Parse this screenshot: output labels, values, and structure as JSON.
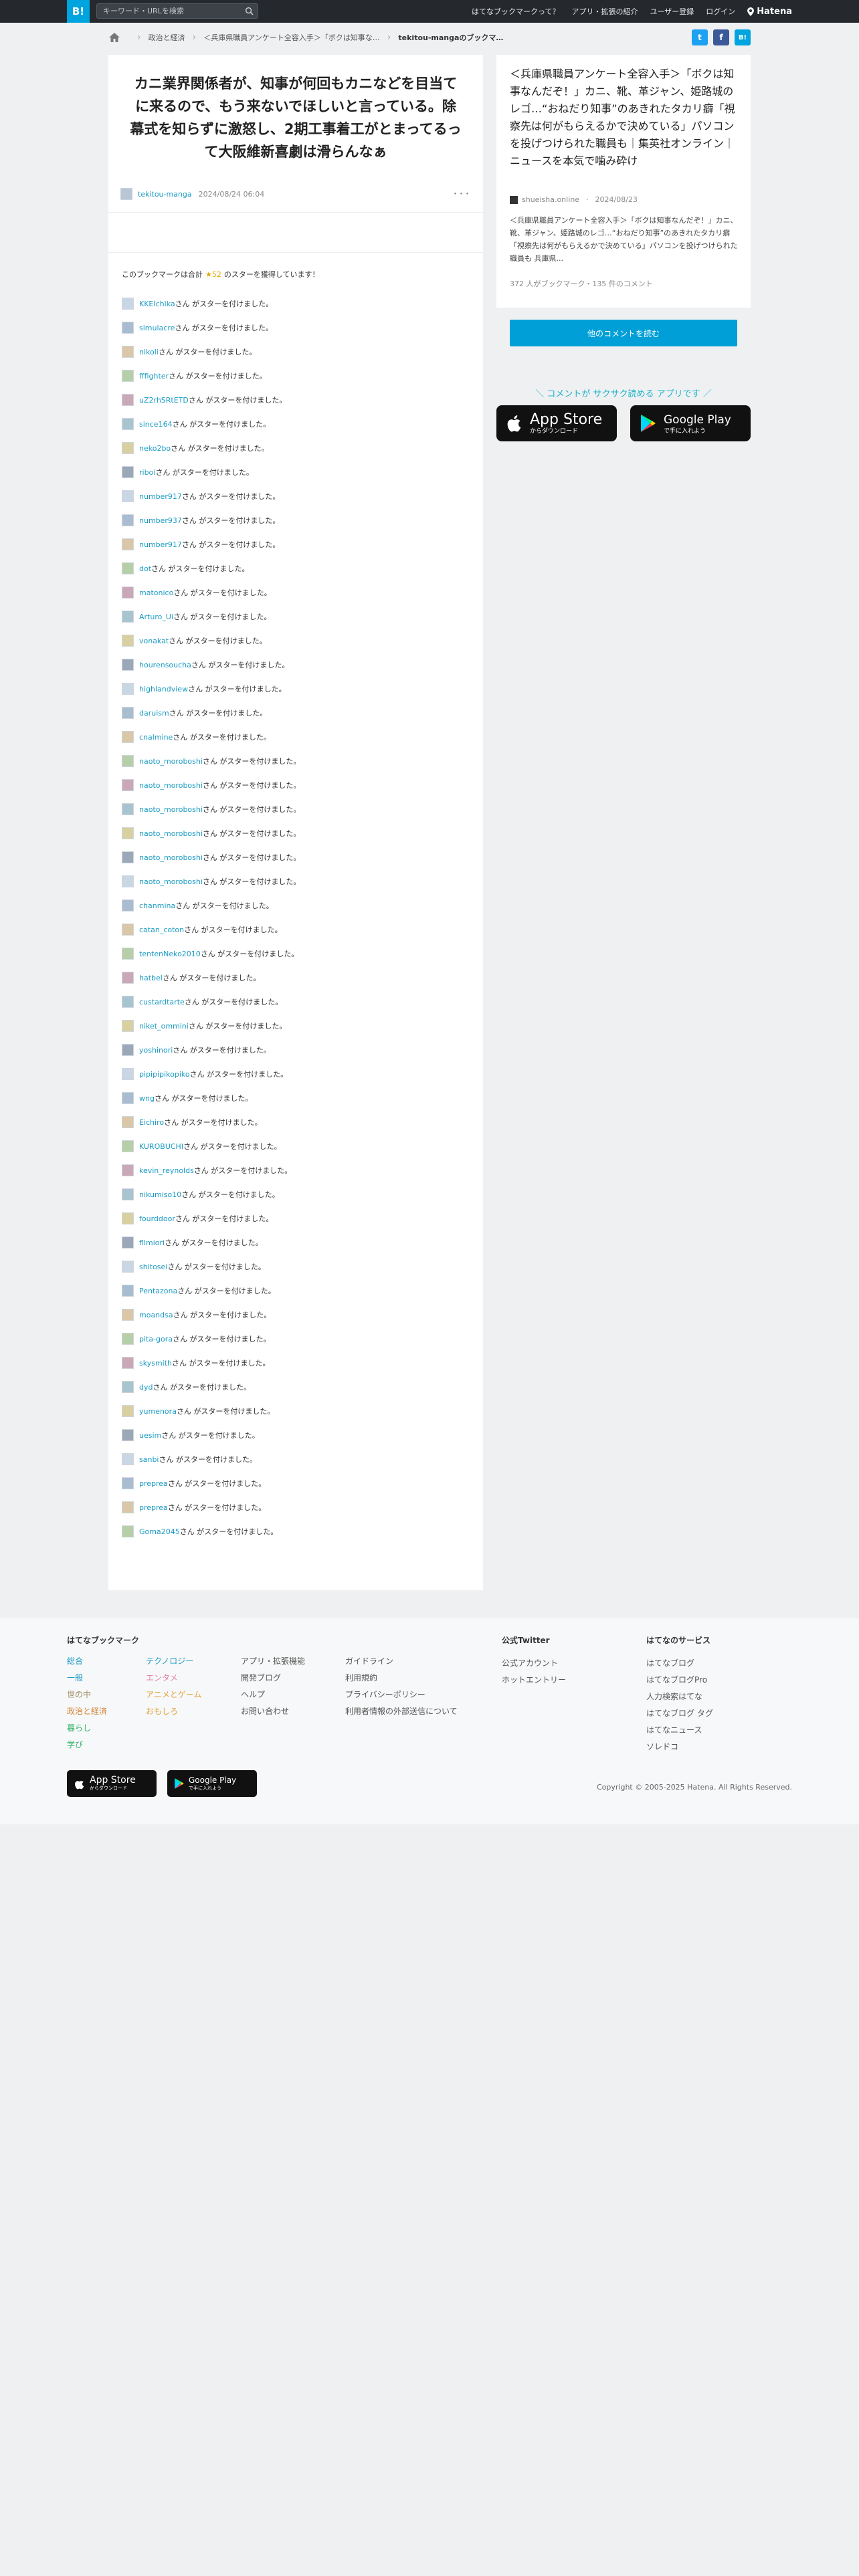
{
  "topbar": {
    "logo": "B!",
    "search_placeholder": "キーワード・URLを検索",
    "links": [
      "はてなブックマークって？",
      "アプリ・拡張の紹介",
      "ユーザー登録",
      "ログイン"
    ],
    "brand": "Hatena"
  },
  "breadcrumb": {
    "items": [
      "政治と経済",
      "＜兵庫県職員アンケート全容入手＞「ボクは知事な…"
    ],
    "current": "tekitou-mangaのブックマ…"
  },
  "share": {
    "twitter": "t",
    "facebook": "f",
    "hatena": "B!"
  },
  "bookmark": {
    "title": "カニ業界関係者が、知事が何回もカニなどを目当てに来るので、もう来ないでほしいと言っている。除幕式を知らずに激怒し、2期工事着工がとまってるって大阪維新喜劇は滑らんなぁ",
    "user": "tekitou-manga",
    "date": "2024/08/24 06:04",
    "more": "･･･"
  },
  "stars": {
    "summary_before": "このブックマークは合計",
    "summary_count": "★52",
    "summary_after": "のスターを獲得しています！",
    "suffix": "さん がスターを付けました。",
    "users": [
      "KKEIchika",
      "simulacre",
      "nikoli",
      "fffighter",
      "uZ2rhSRtETD",
      "since164",
      "neko2bo",
      "riboi",
      "number917",
      "number937",
      "number917",
      "dot",
      "matonico",
      "Arturo_Ui",
      "vonakat",
      "hourensoucha",
      "highlandview",
      "daruism",
      "cnalmine",
      "naoto_moroboshi",
      "naoto_moroboshi",
      "naoto_moroboshi",
      "naoto_moroboshi",
      "naoto_moroboshi",
      "naoto_moroboshi",
      "chanmina",
      "catan_coton",
      "tentenNeko2010",
      "hatbel",
      "custardtarte",
      "niket_ommini",
      "yoshinori",
      "pipipipikopiko",
      "wng",
      "Eichiro",
      "KUROBUCHI",
      "kevin_reynolds",
      "nikumiso10",
      "fourddoor",
      "fllmiori",
      "shitosei",
      "Pentazona",
      "moandsa",
      "pita-gora",
      "skysmith",
      "dyd",
      "yumenora",
      "uesim",
      "sanbi",
      "preprea",
      "preprea",
      "Goma2045"
    ]
  },
  "entry": {
    "title": "＜兵庫県職員アンケート全容入手＞「ボクは知事なんだぞ！」カニ、靴、革ジャン、姫路城のレゴ…“おねだり知事”のあきれたタカリ癖「視察先は何がもらえるかで決めている」パソコンを投げつけられた職員も｜集英社オンライン｜ニュースを本気で噛み砕け",
    "publisher": "shueisha.online",
    "date": "2024/08/23",
    "description": "＜兵庫県職員アンケート全容入手＞「ボクは知事なんだぞ！」カニ、靴、革ジャン、姫路城のレゴ…“おねだり知事”のあきれたタカリ癖「視察先は何がもらえるかで決めている」パソコンを投げつけられた職員も 兵庫県...",
    "stats": "372 人がブックマーク・135 件のコメント",
    "read_button": "他のコメントを読む"
  },
  "promo": {
    "text": "＼ コメントが サクサク読める アプリです ／",
    "appstore_big": "App Store",
    "appstore_small": "からダウンロード",
    "gplay_big": "Google Play",
    "gplay_small": "で手に入れよう"
  },
  "footer": {
    "col1_title": "はてなブックマーク",
    "col1": [
      "総合",
      "一般",
      "世の中",
      "政治と経済",
      "暮らし",
      "学び"
    ],
    "col2": [
      "テクノロジー",
      "エンタメ",
      "アニメとゲーム",
      "おもしろ"
    ],
    "col3": [
      "アプリ・拡張機能",
      "開発ブログ",
      "ヘルプ",
      "お問い合わせ"
    ],
    "col4": [
      "ガイドライン",
      "利用規約",
      "プライバシーポリシー",
      "利用者情報の外部送信について"
    ],
    "col5_title": "公式Twitter",
    "col5": [
      "公式アカウント",
      "ホットエントリー"
    ],
    "col6_title": "はてなのサービス",
    "col6": [
      "はてなブログ",
      "はてなブログPro",
      "人力検索はてな",
      "はてなブログ タグ",
      "はてなニュース",
      "ソレドコ"
    ],
    "appstore_big": "App Store",
    "appstore_small": "からダウンロード",
    "gplay_big": "Google Play",
    "gplay_small": "で手に入れよう",
    "copyright": "Copyright © 2005-2025 Hatena. All Rights Reserved."
  },
  "colors": {
    "accent": "#00a4de",
    "link": "#1a9bc4",
    "star": "#e5a400",
    "twitter": "#1da1f2",
    "facebook": "#3b5998"
  }
}
